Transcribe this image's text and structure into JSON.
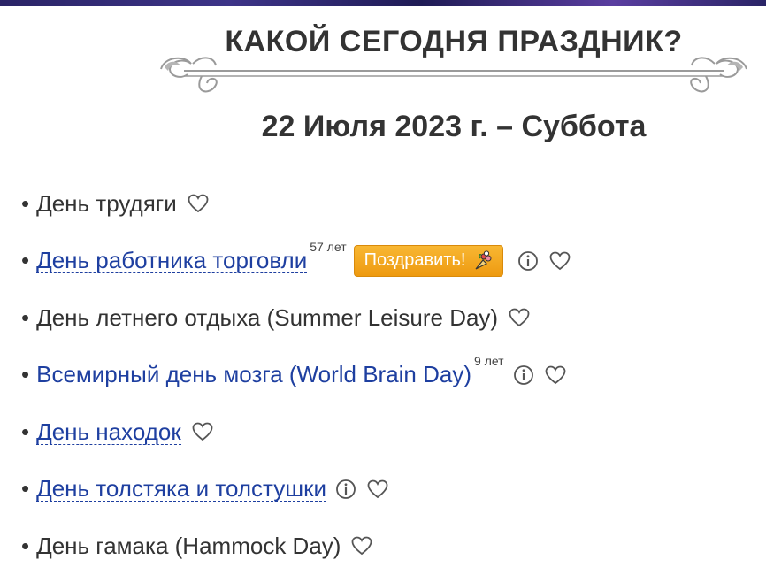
{
  "page": {
    "title": "КАКОЙ СЕГОДНЯ ПРАЗДНИК?",
    "date": "22 Июля 2023 г. – Суббота"
  },
  "colors": {
    "link": "#1e3fa0",
    "text": "#333333",
    "button_orange": "#f2a51d"
  },
  "holidays": [
    {
      "bullet": "•",
      "name": "День трудяги",
      "is_link": false,
      "age": "",
      "has_congrats": false,
      "has_info": false
    },
    {
      "bullet": "•",
      "name": "День работника торговли",
      "is_link": true,
      "age": "57 лет",
      "has_congrats": true,
      "congrats_label": "Поздравить!",
      "has_info": true
    },
    {
      "bullet": "•",
      "name": "День летнего отдыха (Summer Leisure Day)",
      "is_link": false,
      "age": "",
      "has_congrats": false,
      "has_info": false
    },
    {
      "bullet": "•",
      "name": "Всемирный день мозга (World Brain Day)",
      "is_link": true,
      "age": "9 лет",
      "has_congrats": false,
      "has_info": true
    },
    {
      "bullet": "•",
      "name": "День находок",
      "is_link": true,
      "age": "",
      "has_congrats": false,
      "has_info": false
    },
    {
      "bullet": "•",
      "name": "День толстяка и толстушки",
      "is_link": true,
      "age": "",
      "has_congrats": false,
      "has_info": true
    },
    {
      "bullet": "•",
      "name": "День гамака (Hammock Day)",
      "is_link": false,
      "age": "",
      "has_congrats": false,
      "has_info": false
    }
  ],
  "icons": {
    "favorite": "heart-outline-icon",
    "info": "info-circle-icon",
    "congrats": "flower-bouquet-icon",
    "ornament": "swirl-divider-ornament"
  }
}
